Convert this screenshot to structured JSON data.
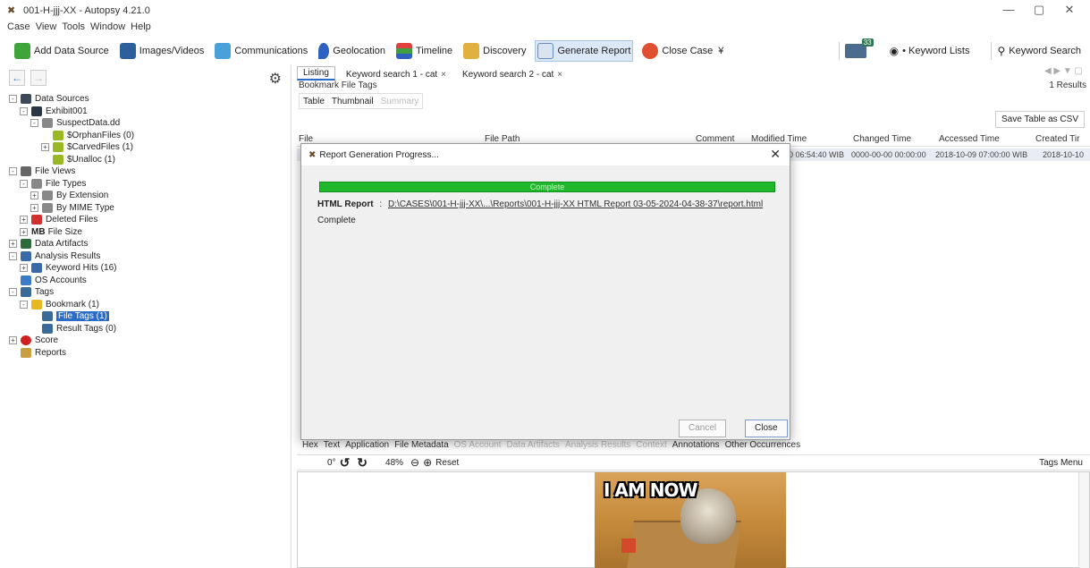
{
  "window": {
    "title": "001-H-jjj-XX - Autopsy 4.21.0",
    "controls": [
      "—",
      "▢",
      "✕"
    ]
  },
  "menu": [
    "Case",
    "View",
    "Tools",
    "Window",
    "Help"
  ],
  "toolbar": {
    "add_data_source": "Add Data Source",
    "images_videos": "Images/Videos",
    "communications": "Communications",
    "geolocation": "Geolocation",
    "timeline": "Timeline",
    "discovery": "Discovery",
    "generate_report": "Generate Report",
    "close_case": "Close Case",
    "overflow": "¥",
    "mail_badge": "33",
    "keyword_lists": "• Keyword Lists",
    "keyword_search": "Keyword Search"
  },
  "tree": [
    {
      "label": "Data Sources",
      "level": 0,
      "exp": "-",
      "icon": "datasource"
    },
    {
      "label": "Exhibit001",
      "level": 1,
      "exp": "-",
      "icon": "image"
    },
    {
      "label": "SuspectData.dd",
      "level": 2,
      "exp": "-",
      "icon": "disk"
    },
    {
      "label": "$OrphanFiles (0)",
      "level": 3,
      "exp": "",
      "icon": "folder"
    },
    {
      "label": "$CarvedFiles (1)",
      "level": 3,
      "exp": "+",
      "icon": "folder"
    },
    {
      "label": "$Unalloc (1)",
      "level": 3,
      "exp": "",
      "icon": "folder"
    },
    {
      "label": "File Views",
      "level": 0,
      "exp": "-",
      "icon": "views"
    },
    {
      "label": "File Types",
      "level": 1,
      "exp": "-",
      "icon": "types"
    },
    {
      "label": "By Extension",
      "level": 2,
      "exp": "+",
      "icon": "types"
    },
    {
      "label": "By MIME Type",
      "level": 2,
      "exp": "+",
      "icon": "types"
    },
    {
      "label": "Deleted Files",
      "level": 1,
      "exp": "+",
      "icon": "deleted"
    },
    {
      "label": "File Size",
      "level": 1,
      "exp": "+",
      "icon": "mb"
    },
    {
      "label": "Data Artifacts",
      "level": 0,
      "exp": "+",
      "icon": "artifacts"
    },
    {
      "label": "Analysis Results",
      "level": 0,
      "exp": "-",
      "icon": "analysis"
    },
    {
      "label": "Keyword Hits (16)",
      "level": 1,
      "exp": "+",
      "icon": "analysis"
    },
    {
      "label": "OS Accounts",
      "level": 0,
      "exp": "",
      "icon": "accounts"
    },
    {
      "label": "Tags",
      "level": 0,
      "exp": "-",
      "icon": "tags"
    },
    {
      "label": "Bookmark (1)",
      "level": 1,
      "exp": "-",
      "icon": "star"
    },
    {
      "label": "File Tags (1)",
      "level": 2,
      "exp": "",
      "icon": "tags",
      "selected": true
    },
    {
      "label": "Result Tags (0)",
      "level": 2,
      "exp": "",
      "icon": "tags"
    },
    {
      "label": "Score",
      "level": 0,
      "exp": "+",
      "icon": "score"
    },
    {
      "label": "Reports",
      "level": 0,
      "exp": "",
      "icon": "reports"
    }
  ],
  "content": {
    "tabs": [
      {
        "label": "Listing",
        "active": true,
        "close": ""
      },
      {
        "label": "Keyword search 1 - cat",
        "active": false,
        "close": "×"
      },
      {
        "label": "Keyword search 2 - cat",
        "active": false,
        "close": "×"
      }
    ],
    "tab_nav": "◀ ▶ ▼ ▢",
    "section_title": "Bookmark File Tags",
    "results": "1  Results",
    "subtabs": [
      "Table",
      "Thumbnail",
      "Summary"
    ],
    "save_csv": "Save Table as CSV",
    "columns": [
      "File",
      "File Path",
      "Comment",
      "Modified Time",
      "Changed Time",
      "Accessed Time",
      "Created Tir"
    ],
    "row": {
      "modified": "0 06:54:40 WIB",
      "changed": "0000-00-00 00:00:00",
      "accessed": "2018-10-09 07:00:00 WIB",
      "created": "2018-10-10"
    },
    "bottom_tabs": [
      "Hex",
      "Text",
      "Application",
      "File Metadata",
      "OS Account",
      "Data Artifacts",
      "Analysis Results",
      "Context",
      "Annotations",
      "Other Occurrences"
    ],
    "viewer": {
      "rotation": "0°",
      "zoom": "48%",
      "reset": "Reset",
      "tags_menu": "Tags Menu",
      "image_caption": "I AM NOW"
    }
  },
  "dialog": {
    "title": "Report Generation Progress...",
    "progress_label": "Complete",
    "progress": 1.0,
    "report_type": "HTML Report",
    "report_sep": ":",
    "report_path": "D:\\CASES\\001-H-jjj-XX\\...\\Reports\\001-H-jjj-XX HTML Report 03-05-2024-04-38-37\\report.html",
    "status": "Complete",
    "cancel": "Cancel",
    "close": "Close"
  }
}
